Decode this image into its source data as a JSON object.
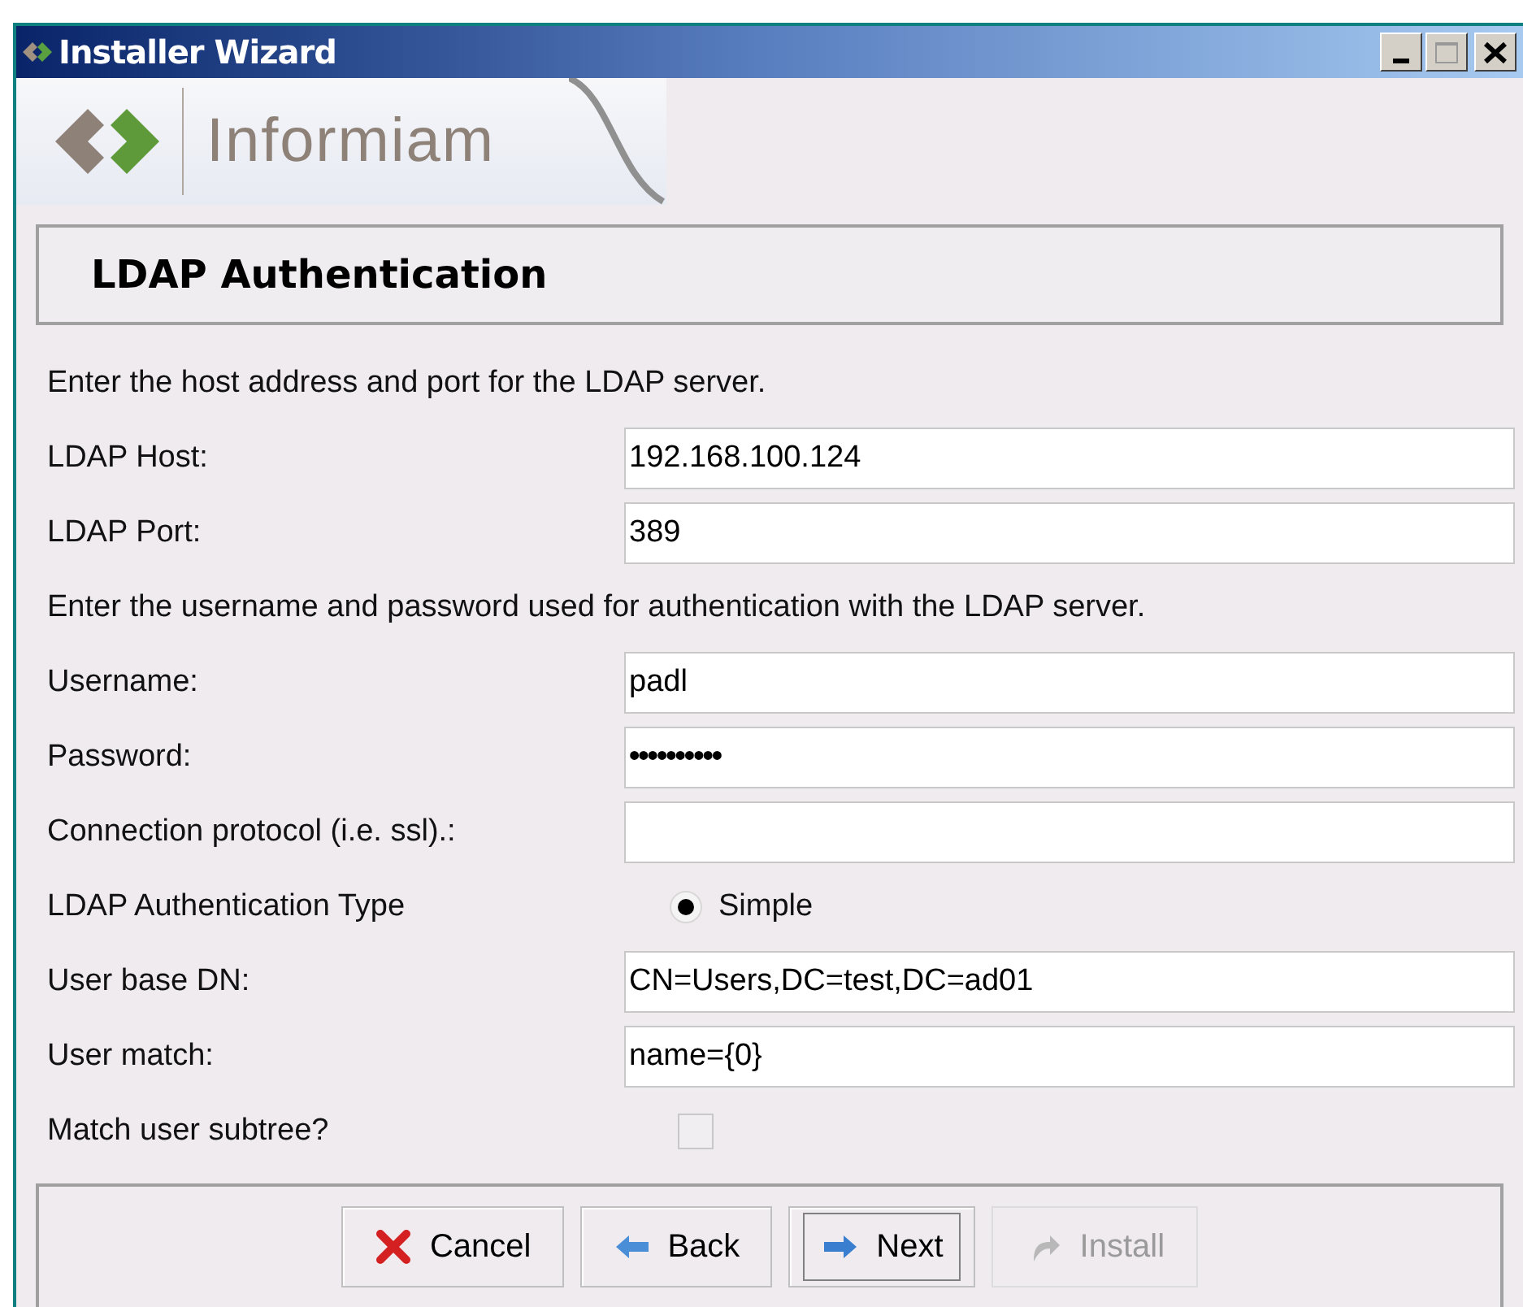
{
  "window": {
    "title": "Installer Wizard"
  },
  "banner": {
    "logo_text": "Informiam"
  },
  "page_title": "LDAP Authentication",
  "rows": [
    {
      "kind": "note",
      "text": "Enter the host address and port for the LDAP server."
    },
    {
      "kind": "text",
      "label": "LDAP Host:",
      "value": "192.168.100.124"
    },
    {
      "kind": "text",
      "label": "LDAP Port:",
      "value": "389"
    },
    {
      "kind": "note",
      "text": "Enter the username and password used for authentication with the LDAP server."
    },
    {
      "kind": "text",
      "label": "Username:",
      "value": "padl"
    },
    {
      "kind": "password",
      "label": "Password:",
      "value": "••••••••••"
    },
    {
      "kind": "text",
      "label": "Connection protocol (i.e. ssl).:",
      "value": ""
    },
    {
      "kind": "radio",
      "label": "LDAP Authentication Type",
      "option": "Simple",
      "selected": true
    },
    {
      "kind": "text",
      "label": "User base DN:",
      "value": "CN=Users,DC=test,DC=ad01"
    },
    {
      "kind": "text",
      "label": "User match:",
      "value": "name={0}"
    },
    {
      "kind": "checkbox",
      "label": "Match user subtree?",
      "checked": false
    }
  ],
  "buttons": [
    {
      "kind": "cancel",
      "label": "Cancel",
      "disabled": false,
      "focused": false
    },
    {
      "kind": "back",
      "label": "Back",
      "disabled": false,
      "focused": false
    },
    {
      "kind": "next",
      "label": "Next",
      "disabled": false,
      "focused": true
    },
    {
      "kind": "install",
      "label": "Install",
      "disabled": true,
      "focused": false
    }
  ]
}
